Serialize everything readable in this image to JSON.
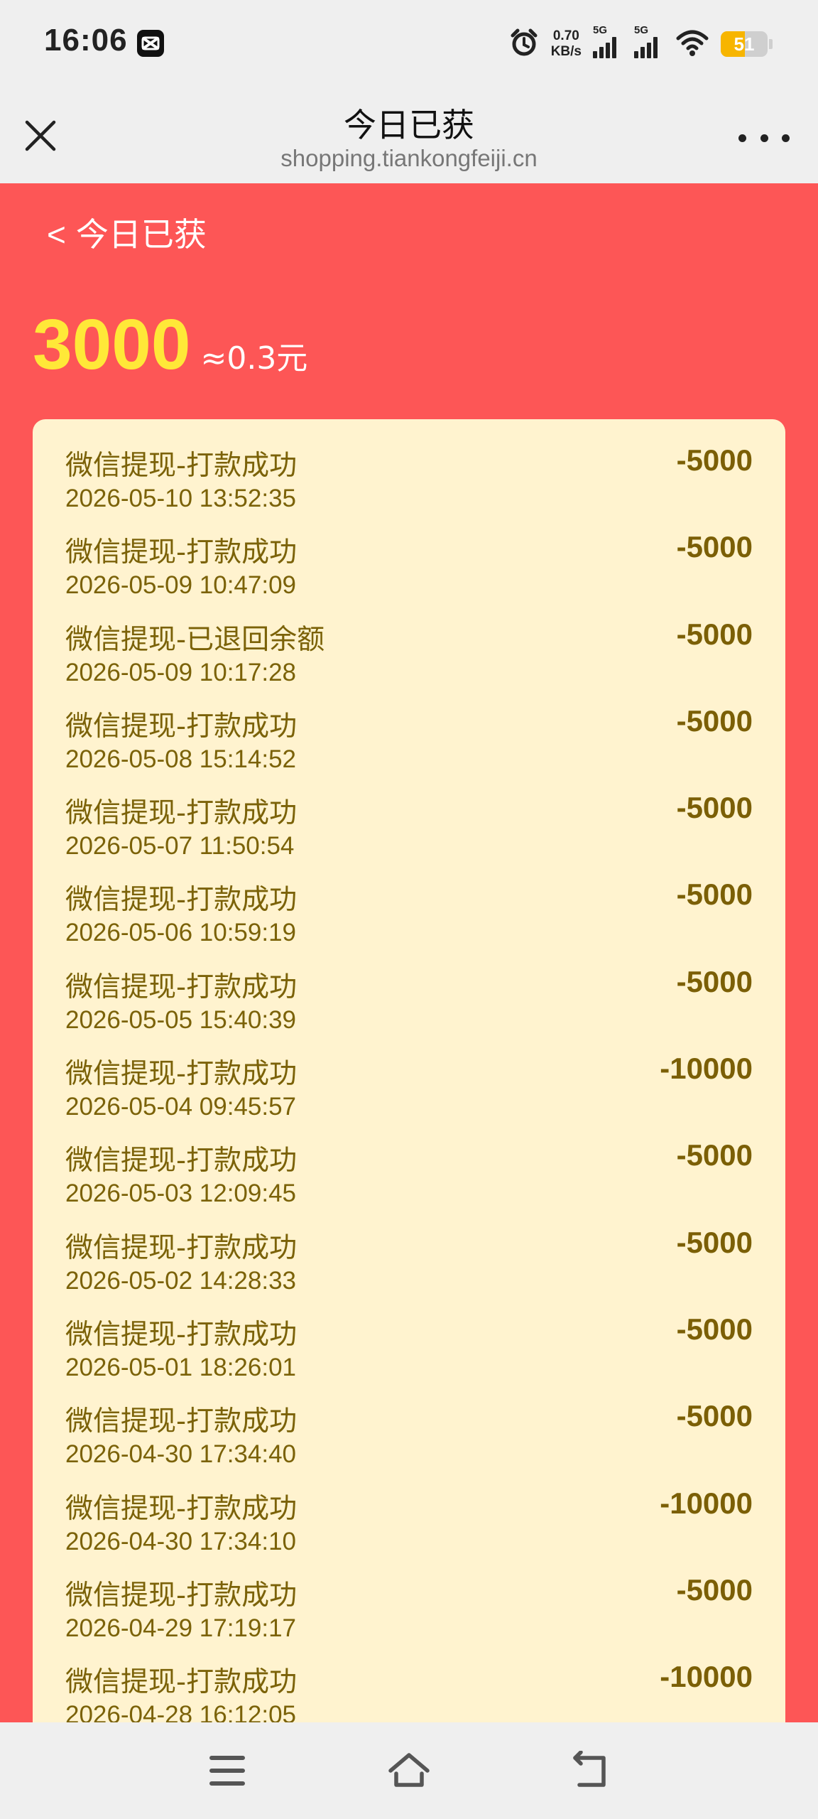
{
  "status_bar": {
    "time": "16:06",
    "speed_value": "0.70",
    "speed_unit": "KB/s",
    "sim1_label": "5G",
    "sim2_label": "5G",
    "battery_level": "51",
    "battery_fraction": 0.51,
    "battery_color": "#f7b500"
  },
  "browser": {
    "title": "今日已获",
    "url": "shopping.tiankongfeiji.cn"
  },
  "page": {
    "back_label": "今日已获",
    "back_chevron": "<",
    "amount": "3000",
    "approx": "≈0.3元",
    "accent_bg": "#fd5656",
    "amount_color": "#ffe838",
    "panel_bg": "#fff3cf",
    "text_color": "#7b6208"
  },
  "records": [
    {
      "title": "微信提现-打款成功",
      "time": "2026-05-10 13:52:35",
      "amount": "-5000"
    },
    {
      "title": "微信提现-打款成功",
      "time": "2026-05-09 10:47:09",
      "amount": "-5000"
    },
    {
      "title": "微信提现-已退回余额",
      "time": "2026-05-09 10:17:28",
      "amount": "-5000"
    },
    {
      "title": "微信提现-打款成功",
      "time": "2026-05-08 15:14:52",
      "amount": "-5000"
    },
    {
      "title": "微信提现-打款成功",
      "time": "2026-05-07 11:50:54",
      "amount": "-5000"
    },
    {
      "title": "微信提现-打款成功",
      "time": "2026-05-06 10:59:19",
      "amount": "-5000"
    },
    {
      "title": "微信提现-打款成功",
      "time": "2026-05-05 15:40:39",
      "amount": "-5000"
    },
    {
      "title": "微信提现-打款成功",
      "time": "2026-05-04 09:45:57",
      "amount": "-10000"
    },
    {
      "title": "微信提现-打款成功",
      "time": "2026-05-03 12:09:45",
      "amount": "-5000"
    },
    {
      "title": "微信提现-打款成功",
      "time": "2026-05-02 14:28:33",
      "amount": "-5000"
    },
    {
      "title": "微信提现-打款成功",
      "time": "2026-05-01 18:26:01",
      "amount": "-5000"
    },
    {
      "title": "微信提现-打款成功",
      "time": "2026-04-30 17:34:40",
      "amount": "-5000"
    },
    {
      "title": "微信提现-打款成功",
      "time": "2026-04-30 17:34:10",
      "amount": "-10000"
    },
    {
      "title": "微信提现-打款成功",
      "time": "2026-04-29 17:19:17",
      "amount": "-5000"
    },
    {
      "title": "微信提现-打款成功",
      "time": "2026-04-28 16:12:05",
      "amount": "-10000"
    }
  ],
  "icons": {
    "close": "close-icon",
    "more": "more-icon",
    "menu": "menu-icon",
    "home": "home-icon",
    "back": "back-icon"
  }
}
